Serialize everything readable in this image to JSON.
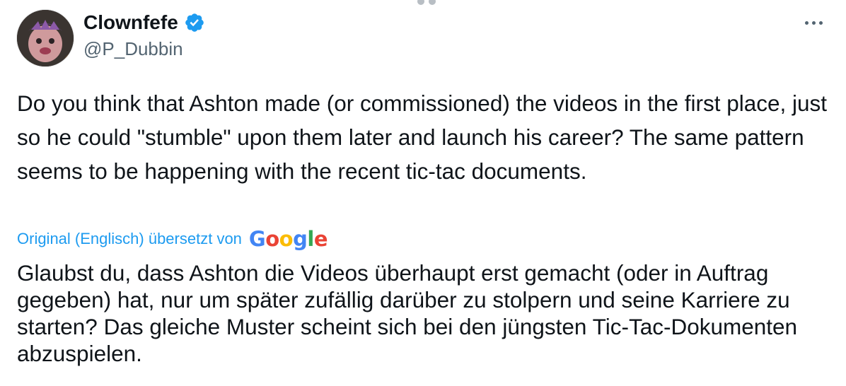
{
  "author": {
    "display_name": "Clownfefe",
    "handle": "@P_Dubbin",
    "verified": true
  },
  "icons": {
    "verified": "verified-badge-icon",
    "more": "more-options-icon",
    "avatar": "avatar-image"
  },
  "tweet": {
    "text": "Do you think that Ashton made (or commissioned) the videos in the first place, just so he could \"stumble\" upon them later and launch his career? The same pattern seems to be happening with the recent tic-tac documents.",
    "translation_label": "Original (Englisch) übersetzt von",
    "translation_provider": "Google",
    "translated_text": "Glaubst du, dass Ashton die Videos überhaupt erst gemacht (oder in Auftrag gegeben) hat, nur um später zufällig darüber zu stolpern und seine Karriere zu starten? Das gleiche Muster scheint sich bei den jüngsten Tic-Tac-Dokumenten abzuspielen."
  },
  "colors": {
    "text": "#0f1419",
    "secondary_text": "#536471",
    "link": "#1d9bf0",
    "verified": "#1d9bf0",
    "google_blue": "#4285f4",
    "google_red": "#ea4335",
    "google_yellow": "#fbbc05",
    "google_green": "#34a853"
  }
}
